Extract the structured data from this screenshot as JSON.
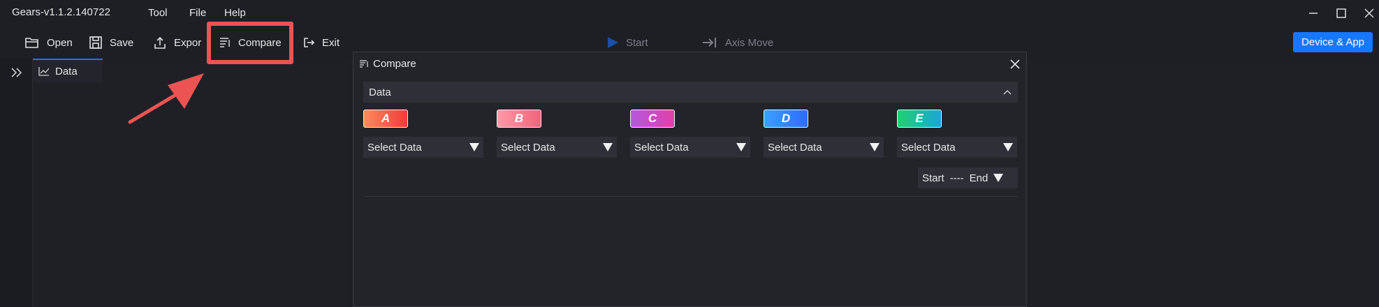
{
  "app": {
    "title": "Gears-v1.1.2.140722"
  },
  "menu": [
    "Tool",
    "File",
    "Help"
  ],
  "toolbar": {
    "open": "Open",
    "save": "Save",
    "export": "Expor",
    "compare": "Compare",
    "exit": "Exit",
    "start": "Start",
    "axis_move": "Axis Move",
    "device_app": "Device & App"
  },
  "tabs": {
    "data": "Data"
  },
  "dialog": {
    "title": "Compare",
    "section_label": "Data",
    "slots": [
      {
        "letter": "A",
        "select": "Select Data",
        "gradient": [
          "#ff8a5b",
          "#ef3b3b"
        ]
      },
      {
        "letter": "B",
        "select": "Select Data",
        "gradient": [
          "#ff9aa8",
          "#f0647a"
        ]
      },
      {
        "letter": "C",
        "select": "Select Data",
        "gradient": [
          "#b558e0",
          "#e040a8"
        ]
      },
      {
        "letter": "D",
        "select": "Select Data",
        "gradient": [
          "#3aa0ff",
          "#2f6bff"
        ]
      },
      {
        "letter": "E",
        "select": "Select Data",
        "gradient": [
          "#20d070",
          "#1aa6d8"
        ]
      }
    ],
    "range": {
      "start": "Start",
      "separator": "----",
      "end": "End"
    }
  },
  "colors": {
    "accent": "#1677ff",
    "highlight": "#ec5454"
  }
}
